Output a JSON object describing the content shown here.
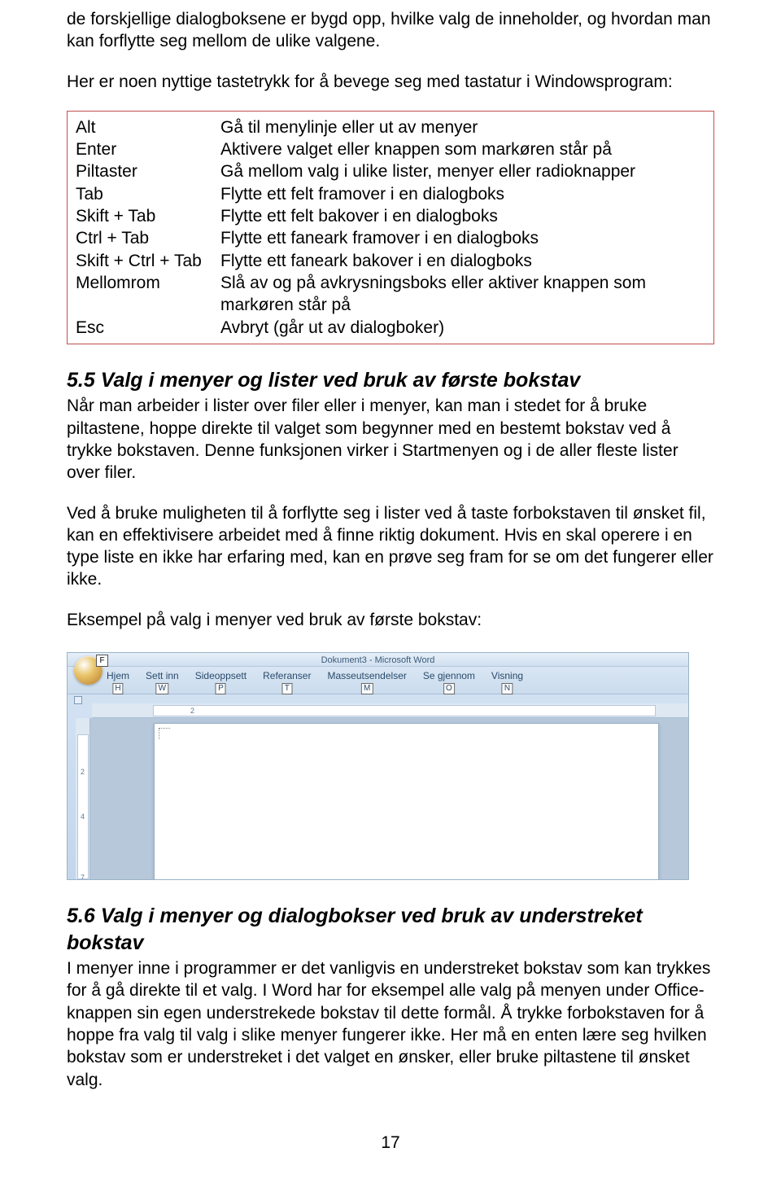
{
  "intro": {
    "p1": "de forskjellige dialogboksene er bygd opp, hvilke valg de inneholder, og hvordan man kan forflytte seg mellom de ulike valgene.",
    "p2": "Her er noen nyttige tastetrykk for å bevege seg med tastatur i Windowsprogram:"
  },
  "shortcuts": [
    {
      "key": "Alt",
      "desc": "Gå til menylinje eller ut av menyer"
    },
    {
      "key": "Enter",
      "desc": "Aktivere valget eller knappen som markøren står på"
    },
    {
      "key": "Piltaster",
      "desc": "Gå mellom valg i ulike lister, menyer eller radioknapper"
    },
    {
      "key": "Tab",
      "desc": "Flytte ett felt framover i en dialogboks"
    },
    {
      "key": "Skift + Tab",
      "desc": "Flytte ett felt bakover i en dialogboks"
    },
    {
      "key": "Ctrl + Tab",
      "desc": "Flytte ett faneark framover i en dialogboks"
    },
    {
      "key": "Skift + Ctrl + Tab",
      "desc": "Flytte ett faneark bakover i en dialogboks"
    },
    {
      "key": "Mellomrom",
      "desc": "Slå av og på avkrysningsboks eller aktiver knappen som markøren står på"
    },
    {
      "key": "Esc",
      "desc": "Avbryt (går ut av dialogboker)"
    }
  ],
  "section55": {
    "heading": "5.5 Valg i menyer og lister ved bruk av første bokstav",
    "p1": "Når man arbeider i lister over filer eller i menyer, kan man i stedet for å bruke piltastene, hoppe direkte til valget som begynner med en bestemt bokstav ved å trykke bokstaven. Denne funksjonen virker i Startmenyen og i de aller fleste lister over filer.",
    "p2": "Ved å bruke muligheten til å forflytte seg i lister ved å taste forbokstaven til ønsket fil, kan en effektivisere arbeidet med å finne riktig dokument. Hvis en skal operere i en type liste en ikke har erfaring med, kan en prøve seg fram for se om det fungerer eller ikke.",
    "p3": "Eksempel på valg i menyer ved bruk av første bokstav:"
  },
  "word": {
    "title": "Dokument3 - Microsoft Word",
    "officeKey": "F",
    "tabs": [
      {
        "label": "Hjem",
        "key": "H"
      },
      {
        "label": "Sett inn",
        "key": "W"
      },
      {
        "label": "Sideoppsett",
        "key": "P"
      },
      {
        "label": "Referanser",
        "key": "T"
      },
      {
        "label": "Masseutsendelser",
        "key": "M"
      },
      {
        "label": "Se gjennom",
        "key": "O"
      },
      {
        "label": "Visning",
        "key": "N"
      }
    ],
    "hticks": [
      "2"
    ],
    "vticks": [
      "2",
      "4",
      "7"
    ]
  },
  "section56": {
    "heading": "5.6 Valg i menyer og dialogbokser ved bruk av understreket bokstav",
    "p1": "I menyer inne i programmer er det vanligvis en understreket bokstav som kan trykkes for å gå direkte til et valg. I Word har for eksempel alle valg på menyen under Office-knappen sin egen understrekede bokstav til dette formål. Å trykke forbokstaven for å hoppe fra valg til valg i slike menyer fungerer ikke. Her må en enten lære seg hvilken bokstav som er understreket i det valget en ønsker, eller bruke piltastene til ønsket valg."
  },
  "pageNumber": "17"
}
